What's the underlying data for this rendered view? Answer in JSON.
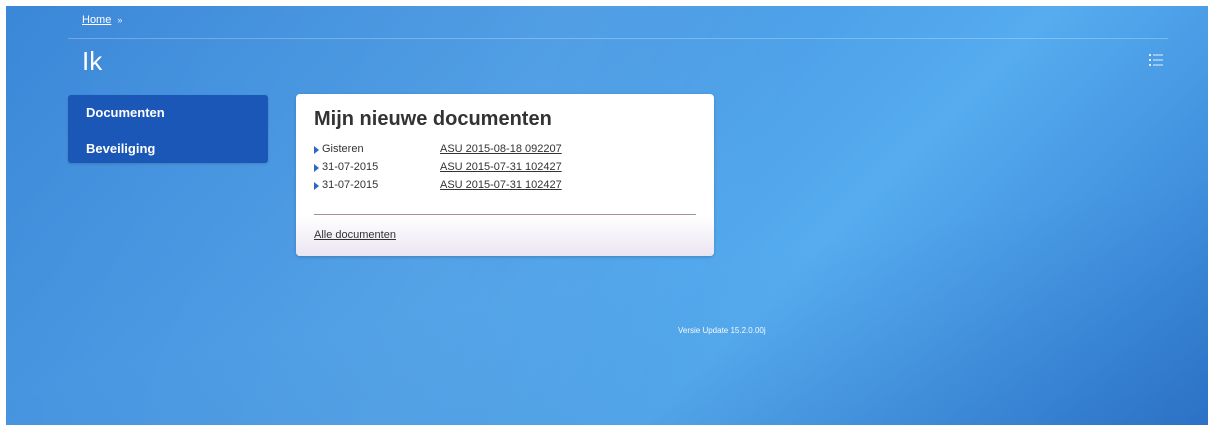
{
  "breadcrumb": {
    "home_label": "Home",
    "separator": "»"
  },
  "page": {
    "title": "Ik"
  },
  "header": {
    "view_toggle_icon": "list-icon"
  },
  "sidebar": {
    "items": [
      {
        "label": "Documenten"
      },
      {
        "label": "Beveiliging"
      }
    ]
  },
  "card": {
    "title": "Mijn nieuwe documenten",
    "documents": [
      {
        "date": "Gisteren",
        "name": "ASU 2015-08-18 092207"
      },
      {
        "date": "31-07-2015",
        "name": "ASU 2015-07-31 102427"
      },
      {
        "date": "31-07-2015",
        "name": "ASU 2015-07-31 102427"
      }
    ],
    "footer_link": "Alle documenten"
  },
  "footer": {
    "version": "Versie Update 15.2.0.00j"
  },
  "colors": {
    "background": "#4a9de6",
    "sidebar": "#1b57b6",
    "bullet": "#2b66c8"
  }
}
